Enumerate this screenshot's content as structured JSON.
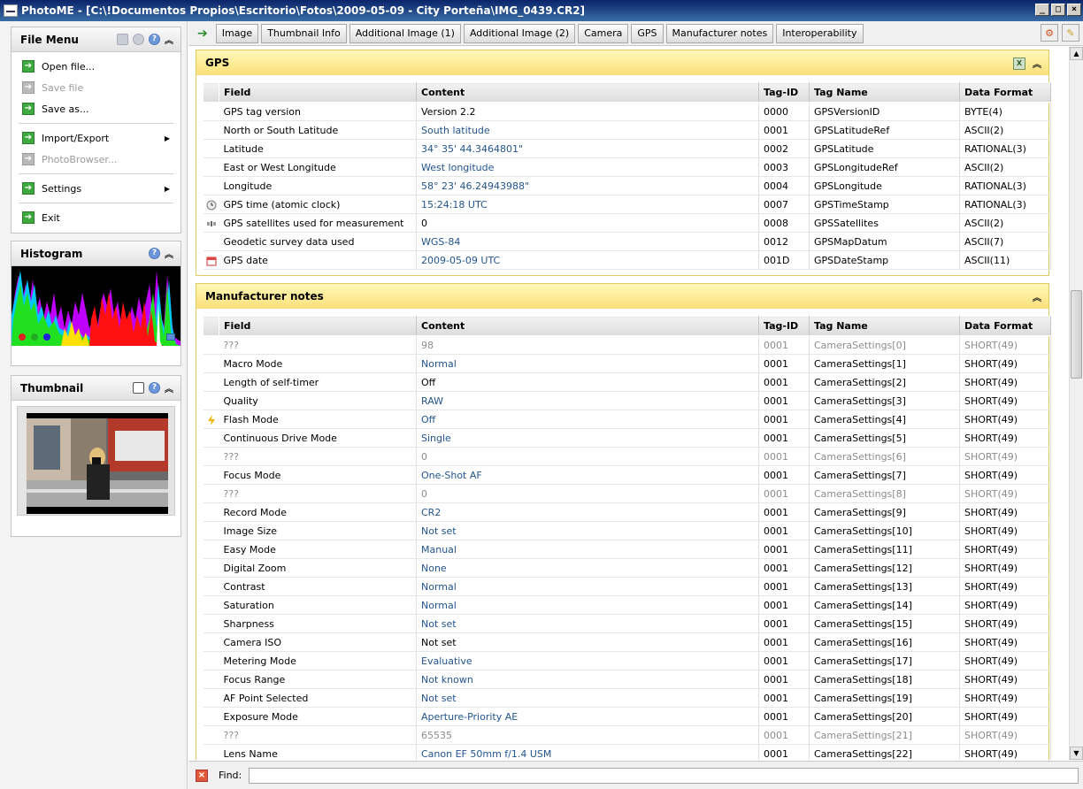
{
  "title": "PhotoME - [C:\\!Documentos Propios\\Escritorio\\Fotos\\2009-05-09 - City Porteña\\IMG_0439.CR2]",
  "file_menu": {
    "title": "File Menu",
    "items": [
      {
        "label": "Open file...",
        "enabled": true,
        "submenu": false
      },
      {
        "label": "Save file",
        "enabled": false,
        "submenu": false
      },
      {
        "label": "Save as...",
        "enabled": true,
        "submenu": false
      },
      {
        "label": "Import/Export",
        "enabled": true,
        "submenu": true
      },
      {
        "label": "PhotoBrowser...",
        "enabled": false,
        "submenu": false
      },
      {
        "label": "Settings",
        "enabled": true,
        "submenu": true
      },
      {
        "label": "Exit",
        "enabled": true,
        "submenu": false
      }
    ]
  },
  "histogram": {
    "title": "Histogram"
  },
  "thumbnail": {
    "title": "Thumbnail"
  },
  "tabs": [
    "Image",
    "Thumbnail Info",
    "Additional Image (1)",
    "Additional Image (2)",
    "Camera",
    "GPS",
    "Manufacturer notes",
    "Interoperability"
  ],
  "columns": [
    "Field",
    "Content",
    "Tag-ID",
    "Tag Name",
    "Data Format"
  ],
  "gps": {
    "title": "GPS",
    "rows": [
      {
        "icon": "",
        "field": "GPS tag version",
        "content": "Version 2.2",
        "tag_id": "0000",
        "tag_name": "GPSVersionID",
        "format": "BYTE(4)",
        "value_style": "plain"
      },
      {
        "icon": "",
        "field": "North or South Latitude",
        "content": "South latitude",
        "tag_id": "0001",
        "tag_name": "GPSLatitudeRef",
        "format": "ASCII(2)",
        "value_style": "blue"
      },
      {
        "icon": "",
        "field": "Latitude",
        "content": "34° 35' 44.3464801\"",
        "tag_id": "0002",
        "tag_name": "GPSLatitude",
        "format": "RATIONAL(3)",
        "value_style": "blue"
      },
      {
        "icon": "",
        "field": "East or West Longitude",
        "content": "West longitude",
        "tag_id": "0003",
        "tag_name": "GPSLongitudeRef",
        "format": "ASCII(2)",
        "value_style": "blue"
      },
      {
        "icon": "",
        "field": "Longitude",
        "content": "58° 23' 46.24943988\"",
        "tag_id": "0004",
        "tag_name": "GPSLongitude",
        "format": "RATIONAL(3)",
        "value_style": "blue"
      },
      {
        "icon": "clock-icon",
        "field": "GPS time (atomic clock)",
        "content": "15:24:18 UTC",
        "tag_id": "0007",
        "tag_name": "GPSTimeStamp",
        "format": "RATIONAL(3)",
        "value_style": "blue"
      },
      {
        "icon": "satellite-icon",
        "field": "GPS satellites used for measurement",
        "content": "0",
        "tag_id": "0008",
        "tag_name": "GPSSatellites",
        "format": "ASCII(2)",
        "value_style": "plain"
      },
      {
        "icon": "",
        "field": "Geodetic survey data used",
        "content": "WGS-84",
        "tag_id": "0012",
        "tag_name": "GPSMapDatum",
        "format": "ASCII(7)",
        "value_style": "blue"
      },
      {
        "icon": "calendar-icon",
        "field": "GPS date",
        "content": "2009-05-09 UTC",
        "tag_id": "001D",
        "tag_name": "GPSDateStamp",
        "format": "ASCII(11)",
        "value_style": "blue"
      }
    ]
  },
  "maker": {
    "title": "Manufacturer notes",
    "rows": [
      {
        "icon": "",
        "field": "???",
        "content": "98",
        "tag_id": "0001",
        "tag_name": "CameraSettings[0]",
        "format": "SHORT(49)",
        "value_style": "grey"
      },
      {
        "icon": "",
        "field": "Macro Mode",
        "content": "Normal",
        "tag_id": "0001",
        "tag_name": "CameraSettings[1]",
        "format": "SHORT(49)",
        "value_style": "blue"
      },
      {
        "icon": "",
        "field": "Length of self-timer",
        "content": "Off",
        "tag_id": "0001",
        "tag_name": "CameraSettings[2]",
        "format": "SHORT(49)",
        "value_style": "plain"
      },
      {
        "icon": "",
        "field": "Quality",
        "content": "RAW",
        "tag_id": "0001",
        "tag_name": "CameraSettings[3]",
        "format": "SHORT(49)",
        "value_style": "blue"
      },
      {
        "icon": "flash-icon",
        "field": "Flash Mode",
        "content": "Off",
        "tag_id": "0001",
        "tag_name": "CameraSettings[4]",
        "format": "SHORT(49)",
        "value_style": "blue"
      },
      {
        "icon": "",
        "field": "Continuous Drive Mode",
        "content": "Single",
        "tag_id": "0001",
        "tag_name": "CameraSettings[5]",
        "format": "SHORT(49)",
        "value_style": "blue"
      },
      {
        "icon": "",
        "field": "???",
        "content": "0",
        "tag_id": "0001",
        "tag_name": "CameraSettings[6]",
        "format": "SHORT(49)",
        "value_style": "grey"
      },
      {
        "icon": "",
        "field": "Focus Mode",
        "content": "One-Shot AF",
        "tag_id": "0001",
        "tag_name": "CameraSettings[7]",
        "format": "SHORT(49)",
        "value_style": "blue"
      },
      {
        "icon": "",
        "field": "???",
        "content": "0",
        "tag_id": "0001",
        "tag_name": "CameraSettings[8]",
        "format": "SHORT(49)",
        "value_style": "grey"
      },
      {
        "icon": "",
        "field": "Record Mode",
        "content": "CR2",
        "tag_id": "0001",
        "tag_name": "CameraSettings[9]",
        "format": "SHORT(49)",
        "value_style": "blue"
      },
      {
        "icon": "",
        "field": "Image Size",
        "content": "Not set",
        "tag_id": "0001",
        "tag_name": "CameraSettings[10]",
        "format": "SHORT(49)",
        "value_style": "blue"
      },
      {
        "icon": "",
        "field": "Easy Mode",
        "content": "Manual",
        "tag_id": "0001",
        "tag_name": "CameraSettings[11]",
        "format": "SHORT(49)",
        "value_style": "blue"
      },
      {
        "icon": "",
        "field": "Digital Zoom",
        "content": "None",
        "tag_id": "0001",
        "tag_name": "CameraSettings[12]",
        "format": "SHORT(49)",
        "value_style": "blue"
      },
      {
        "icon": "",
        "field": "Contrast",
        "content": "Normal",
        "tag_id": "0001",
        "tag_name": "CameraSettings[13]",
        "format": "SHORT(49)",
        "value_style": "blue"
      },
      {
        "icon": "",
        "field": "Saturation",
        "content": "Normal",
        "tag_id": "0001",
        "tag_name": "CameraSettings[14]",
        "format": "SHORT(49)",
        "value_style": "blue"
      },
      {
        "icon": "",
        "field": "Sharpness",
        "content": "Not set",
        "tag_id": "0001",
        "tag_name": "CameraSettings[15]",
        "format": "SHORT(49)",
        "value_style": "blue"
      },
      {
        "icon": "",
        "field": "Camera ISO",
        "content": "Not set",
        "tag_id": "0001",
        "tag_name": "CameraSettings[16]",
        "format": "SHORT(49)",
        "value_style": "plain"
      },
      {
        "icon": "",
        "field": "Metering Mode",
        "content": "Evaluative",
        "tag_id": "0001",
        "tag_name": "CameraSettings[17]",
        "format": "SHORT(49)",
        "value_style": "blue"
      },
      {
        "icon": "",
        "field": "Focus Range",
        "content": "Not known",
        "tag_id": "0001",
        "tag_name": "CameraSettings[18]",
        "format": "SHORT(49)",
        "value_style": "blue"
      },
      {
        "icon": "",
        "field": "AF Point Selected",
        "content": "Not set",
        "tag_id": "0001",
        "tag_name": "CameraSettings[19]",
        "format": "SHORT(49)",
        "value_style": "blue"
      },
      {
        "icon": "",
        "field": "Exposure Mode",
        "content": "Aperture-Priority AE",
        "tag_id": "0001",
        "tag_name": "CameraSettings[20]",
        "format": "SHORT(49)",
        "value_style": "blue"
      },
      {
        "icon": "",
        "field": "???",
        "content": "65535",
        "tag_id": "0001",
        "tag_name": "CameraSettings[21]",
        "format": "SHORT(49)",
        "value_style": "grey"
      },
      {
        "icon": "",
        "field": "Lens Name",
        "content": "Canon EF 50mm f/1.4 USM",
        "tag_id": "0001",
        "tag_name": "CameraSettings[22]",
        "format": "SHORT(49)",
        "value_style": "blue"
      }
    ]
  },
  "find": {
    "label": "Find:",
    "value": "",
    "placeholder": ""
  },
  "colors": {
    "section_header": "#fbe07a",
    "value_blue": "#22558f",
    "titlebar": "#0a246a"
  }
}
